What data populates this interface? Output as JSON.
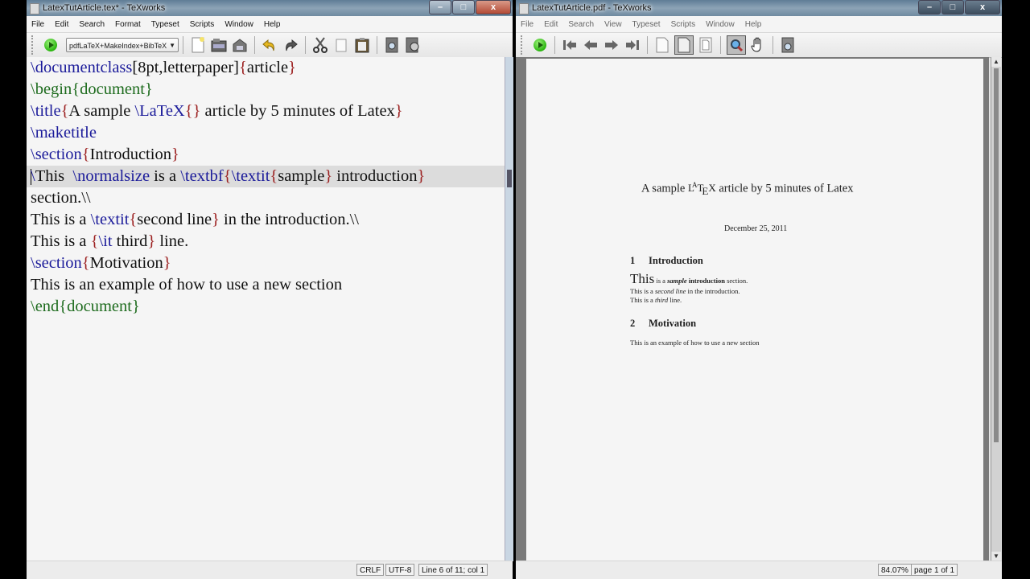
{
  "editor_window": {
    "title": "LatexTutArticle.tex* - TeXworks",
    "window_buttons": {
      "minimize": "–",
      "maximize": "□",
      "close": "x"
    },
    "menu": [
      "File",
      "Edit",
      "Search",
      "Format",
      "Typeset",
      "Scripts",
      "Window",
      "Help"
    ],
    "toolbar": {
      "typeset_engine": "pdfLaTeX+MakeIndex+BibTeX",
      "icons": [
        "typeset-play-icon",
        "new-document-icon",
        "open-folder-icon",
        "save-icon",
        "undo-icon",
        "redo-icon",
        "cut-icon",
        "copy-icon",
        "paste-icon",
        "find-icon",
        "replace-icon"
      ]
    },
    "source_lines": [
      [
        {
          "t": "\\documentclass",
          "c": "cmd"
        },
        {
          "t": "[8pt,letterpaper]",
          "c": "txt"
        },
        {
          "t": "{",
          "c": "br"
        },
        {
          "t": "article",
          "c": "txt"
        },
        {
          "t": "}",
          "c": "br"
        }
      ],
      [
        {
          "t": "\\begin",
          "c": "env"
        },
        {
          "t": "{",
          "c": "env"
        },
        {
          "t": "document",
          "c": "env"
        },
        {
          "t": "}",
          "c": "env"
        }
      ],
      [
        {
          "t": "\\title",
          "c": "cmd"
        },
        {
          "t": "{",
          "c": "br"
        },
        {
          "t": "A sample ",
          "c": "txt"
        },
        {
          "t": "\\LaTeX",
          "c": "cmd"
        },
        {
          "t": "{}",
          "c": "br"
        },
        {
          "t": " article by 5 minutes of Latex",
          "c": "txt"
        },
        {
          "t": "}",
          "c": "br"
        }
      ],
      [
        {
          "t": "\\maketitle",
          "c": "cmd"
        }
      ],
      [
        {
          "t": "\\section",
          "c": "cmd"
        },
        {
          "t": "{",
          "c": "br"
        },
        {
          "t": "Introduction",
          "c": "txt"
        },
        {
          "t": "}",
          "c": "br"
        }
      ],
      [
        {
          "t": "\\",
          "c": "cmd"
        },
        {
          "t": "This  ",
          "c": "txt"
        },
        {
          "t": "\\normalsize",
          "c": "cmd"
        },
        {
          "t": " is a ",
          "c": "txt"
        },
        {
          "t": "\\textbf",
          "c": "cmd"
        },
        {
          "t": "{",
          "c": "br"
        },
        {
          "t": "\\textit",
          "c": "cmd"
        },
        {
          "t": "{",
          "c": "br"
        },
        {
          "t": "sample",
          "c": "txt"
        },
        {
          "t": "}",
          "c": "br"
        },
        {
          "t": " introduction",
          "c": "txt"
        },
        {
          "t": "}",
          "c": "br"
        }
      ],
      [
        {
          "t": "section.\\\\",
          "c": "txt"
        }
      ],
      [
        {
          "t": "This is a ",
          "c": "txt"
        },
        {
          "t": "\\textit",
          "c": "cmd"
        },
        {
          "t": "{",
          "c": "br"
        },
        {
          "t": "second line",
          "c": "txt"
        },
        {
          "t": "}",
          "c": "br"
        },
        {
          "t": " in the introduction.\\\\",
          "c": "txt"
        }
      ],
      [
        {
          "t": "This is a ",
          "c": "txt"
        },
        {
          "t": "{",
          "c": "br"
        },
        {
          "t": "\\it",
          "c": "cmd"
        },
        {
          "t": " third",
          "c": "txt"
        },
        {
          "t": "}",
          "c": "br"
        },
        {
          "t": " line.",
          "c": "txt"
        }
      ],
      [
        {
          "t": "\\section",
          "c": "cmd"
        },
        {
          "t": "{",
          "c": "br"
        },
        {
          "t": "Motivation",
          "c": "txt"
        },
        {
          "t": "}",
          "c": "br"
        }
      ],
      [
        {
          "t": "This is an example of how to use a new section",
          "c": "txt"
        }
      ],
      [
        {
          "t": "\\end",
          "c": "env"
        },
        {
          "t": "{",
          "c": "env"
        },
        {
          "t": "document",
          "c": "env"
        },
        {
          "t": "}",
          "c": "env"
        }
      ]
    ],
    "current_line_index": 5,
    "status": {
      "line_ending": "CRLF",
      "encoding": "UTF-8",
      "position": "Line 6 of 11; col 1"
    }
  },
  "pdf_window": {
    "title": "LatexTutArticle.pdf - TeXworks",
    "window_buttons": {
      "minimize": "–",
      "maximize": "□",
      "close": "x"
    },
    "menu": [
      "File",
      "Edit",
      "Search",
      "View",
      "Typeset",
      "Scripts",
      "Window",
      "Help"
    ],
    "toolbar": {
      "icons": [
        "typeset-play-icon",
        "first-page-icon",
        "previous-page-icon",
        "next-page-icon",
        "last-page-icon",
        "actual-size-icon",
        "fit-width-icon",
        "fit-page-icon",
        "magnify-icon",
        "hand-scroll-icon",
        "go-to-source-icon"
      ]
    },
    "document": {
      "title_prefix": "A sample ",
      "title_latex_logo": "LATEX",
      "title_suffix": " article by 5 minutes of Latex",
      "date": "December 25, 2011",
      "sections": [
        {
          "number": "1",
          "name": "Introduction"
        },
        {
          "number": "2",
          "name": "Motivation"
        }
      ],
      "intro_line1": {
        "big": "This",
        "pre": " is a ",
        "italic_bold": "sample",
        "bold": " introduction",
        "post": " section."
      },
      "intro_line2": {
        "pre": "This is a ",
        "italic": "second line",
        "post": " in the introduction."
      },
      "intro_line3": {
        "pre": "This is a ",
        "italic": "third",
        "post": " line."
      },
      "motivation_text": "This is an example of how to use a new section"
    },
    "status": {
      "zoom": "84.07%",
      "page": "page 1 of 1"
    }
  }
}
